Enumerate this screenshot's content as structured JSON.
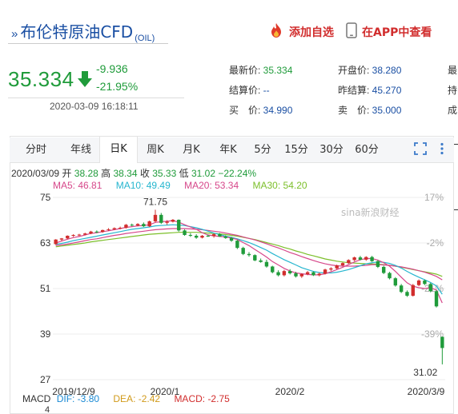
{
  "header": {
    "title_marker": "»",
    "title": "布伦特原油CFD",
    "code": "(OIL)",
    "add_label": "添加自选",
    "app_label": "在APP中查看"
  },
  "quote": {
    "price": "35.334",
    "change": "-9.936",
    "change_pct": "-21.95%",
    "timestamp": "2020-03-09 16:18:11"
  },
  "stats": {
    "c1": [
      {
        "label": "最新价: ",
        "value": "35.334"
      },
      {
        "label": "结算价: ",
        "value": "--"
      },
      {
        "label": "买　价: ",
        "value": "34.990"
      }
    ],
    "c2": [
      {
        "label": "开盘价: ",
        "value": "38.280"
      },
      {
        "label": "昨结算: ",
        "value": "45.270"
      },
      {
        "label": "卖　价: ",
        "value": "35.000"
      }
    ],
    "c3": [
      {
        "label": "最"
      },
      {
        "label": "持"
      },
      {
        "label": "成"
      }
    ]
  },
  "tabs": [
    "分时",
    "年线",
    "日K",
    "周K",
    "月K",
    "年K",
    "5分",
    "15分",
    "30分",
    "60分"
  ],
  "active_tab": "日K",
  "ohlc": {
    "date": "2020/03/09",
    "open_label": "开",
    "open": "38.28",
    "high_label": "高",
    "high": "38.34",
    "close_label": "收",
    "close": "35.33",
    "low_label": "低",
    "low": "31.02",
    "pct": "−22.24%"
  },
  "ma": {
    "ma5": "MA5: 46.81",
    "ma10": "MA10: 49.49",
    "ma20": "MA20: 53.34",
    "ma30": "MA30: 54.20"
  },
  "colors": {
    "up": "#d12d2d",
    "down": "#1f9b3a",
    "ma5": "#d6478a",
    "ma10": "#26b6cf",
    "ma20": "#d6478a",
    "ma30": "#7cbf2a",
    "title": "#1a4fa3"
  },
  "macd": {
    "label": "MACD",
    "dif": "DIF: -3.80",
    "dea": "DEA: -2.42",
    "macd": "MACD: -2.75",
    "scale": "4"
  },
  "chart_data": {
    "type": "candlestick",
    "y_ticks": [
      "75",
      "63",
      "51",
      "39",
      "27"
    ],
    "y_ticks_right": [
      "17%",
      "-2%",
      "-21%",
      "-39%"
    ],
    "ylim": [
      27,
      75
    ],
    "x_ticks": [
      "2019/12/9",
      "2020/1",
      "2020/2",
      "2020/3/9"
    ],
    "high_label": "71.75",
    "low_label": "31.02",
    "watermark": "sina新浪财经",
    "candles": [
      [
        62.7,
        64.0,
        62.5,
        63.9
      ],
      [
        63.9,
        64.3,
        63.5,
        64.2
      ],
      [
        64.2,
        65.0,
        64.0,
        64.9
      ],
      [
        64.9,
        65.3,
        64.6,
        65.1
      ],
      [
        65.1,
        65.4,
        64.8,
        65.2
      ],
      [
        65.2,
        65.7,
        65.0,
        65.5
      ],
      [
        65.5,
        66.2,
        65.3,
        66.0
      ],
      [
        66.0,
        66.3,
        65.6,
        65.9
      ],
      [
        65.9,
        66.5,
        65.7,
        66.4
      ],
      [
        66.4,
        66.9,
        66.2,
        66.6
      ],
      [
        66.6,
        67.1,
        66.4,
        66.9
      ],
      [
        66.9,
        67.3,
        66.6,
        67.0
      ],
      [
        67.0,
        68.0,
        66.8,
        67.8
      ],
      [
        67.8,
        68.1,
        67.4,
        67.6
      ],
      [
        67.6,
        68.2,
        67.4,
        68.0
      ],
      [
        68.0,
        68.4,
        67.2,
        67.4
      ],
      [
        67.4,
        68.9,
        67.2,
        68.7
      ],
      [
        68.7,
        71.75,
        68.4,
        70.4
      ],
      [
        70.4,
        70.9,
        68.0,
        68.3
      ],
      [
        68.3,
        69.0,
        67.8,
        68.6
      ],
      [
        68.6,
        69.3,
        68.4,
        69.1
      ],
      [
        69.1,
        69.2,
        66.0,
        66.3
      ],
      [
        66.3,
        66.6,
        64.9,
        65.1
      ],
      [
        65.1,
        65.6,
        64.6,
        64.9
      ],
      [
        64.9,
        65.3,
        64.1,
        64.4
      ],
      [
        64.4,
        65.1,
        64.2,
        64.9
      ],
      [
        64.9,
        65.2,
        64.6,
        64.8
      ],
      [
        64.8,
        65.5,
        64.4,
        65.3
      ],
      [
        65.3,
        65.6,
        64.6,
        64.7
      ],
      [
        64.7,
        65.0,
        64.1,
        64.3
      ],
      [
        64.3,
        64.6,
        63.3,
        63.6
      ],
      [
        63.6,
        63.8,
        61.4,
        61.7
      ],
      [
        61.7,
        62.0,
        59.8,
        60.1
      ],
      [
        60.1,
        60.6,
        59.4,
        59.8
      ],
      [
        59.8,
        60.0,
        58.2,
        58.4
      ],
      [
        58.4,
        58.9,
        57.8,
        58.0
      ],
      [
        58.0,
        58.6,
        56.5,
        56.8
      ],
      [
        56.8,
        57.0,
        55.0,
        55.3
      ],
      [
        55.3,
        55.8,
        54.2,
        54.5
      ],
      [
        54.5,
        55.9,
        54.2,
        55.6
      ],
      [
        55.6,
        56.1,
        54.7,
        55.0
      ],
      [
        55.0,
        55.4,
        53.9,
        54.2
      ],
      [
        54.2,
        55.0,
        53.8,
        54.8
      ],
      [
        54.8,
        55.6,
        54.5,
        55.3
      ],
      [
        55.3,
        55.5,
        54.3,
        54.5
      ],
      [
        54.5,
        55.2,
        54.2,
        54.9
      ],
      [
        54.9,
        56.2,
        54.7,
        56.0
      ],
      [
        56.0,
        56.6,
        55.6,
        56.3
      ],
      [
        56.3,
        57.3,
        56.0,
        57.1
      ],
      [
        57.1,
        57.9,
        56.8,
        57.7
      ],
      [
        57.7,
        58.7,
        57.5,
        58.5
      ],
      [
        58.5,
        59.4,
        58.2,
        59.2
      ],
      [
        59.2,
        59.6,
        58.4,
        58.6
      ],
      [
        58.6,
        59.5,
        58.3,
        59.3
      ],
      [
        59.3,
        59.6,
        58.0,
        58.2
      ],
      [
        58.2,
        58.5,
        56.4,
        56.7
      ],
      [
        56.7,
        57.0,
        54.8,
        55.1
      ],
      [
        55.1,
        55.4,
        53.4,
        53.7
      ],
      [
        53.7,
        54.0,
        51.5,
        51.8
      ],
      [
        51.8,
        52.2,
        49.8,
        50.1
      ],
      [
        50.1,
        50.5,
        48.8,
        49.1
      ],
      [
        49.1,
        52.2,
        48.9,
        51.9
      ],
      [
        51.9,
        53.4,
        51.6,
        53.1
      ],
      [
        53.1,
        53.4,
        51.9,
        52.2
      ],
      [
        52.2,
        52.5,
        50.0,
        50.3
      ],
      [
        50.3,
        50.6,
        46.0,
        46.3
      ],
      [
        38.28,
        38.34,
        31.02,
        35.33
      ]
    ],
    "ma5": [
      63.0,
      63.5,
      64.0,
      64.4,
      64.7,
      65.1,
      65.5,
      65.7,
      66.0,
      66.2,
      66.5,
      66.8,
      67.1,
      67.3,
      67.5,
      67.6,
      67.8,
      68.4,
      68.6,
      68.7,
      68.9,
      68.5,
      67.8,
      67.2,
      66.6,
      65.7,
      65.1,
      64.9,
      64.7,
      64.6,
      64.3,
      63.9,
      63.1,
      62.3,
      61.3,
      60.3,
      59.3,
      58.1,
      57.2,
      56.3,
      55.6,
      55.1,
      54.9,
      54.7,
      54.6,
      54.6,
      54.9,
      55.4,
      56.0,
      56.6,
      57.3,
      58.0,
      58.6,
      58.9,
      58.9,
      58.5,
      57.8,
      56.9,
      55.5,
      54.0,
      52.5,
      51.6,
      51.2,
      51.0,
      51.2,
      50.6,
      47.2
    ],
    "ma10": [
      62.6,
      62.9,
      63.2,
      63.6,
      63.9,
      64.2,
      64.5,
      64.8,
      65.1,
      65.4,
      65.7,
      66.0,
      66.3,
      66.6,
      66.8,
      67.0,
      67.2,
      67.5,
      67.6,
      67.7,
      67.8,
      67.7,
      67.6,
      67.3,
      67.0,
      66.6,
      66.1,
      65.6,
      65.2,
      64.8,
      64.5,
      64.1,
      63.6,
      63.1,
      62.5,
      61.8,
      61.1,
      60.2,
      59.4,
      58.6,
      57.9,
      57.2,
      56.5,
      56.0,
      55.5,
      55.2,
      55.1,
      55.1,
      55.3,
      55.6,
      56.0,
      56.5,
      57.0,
      57.5,
      57.8,
      58.0,
      57.9,
      57.6,
      57.1,
      56.4,
      55.5,
      54.7,
      54.0,
      53.3,
      52.6,
      51.7,
      49.5
    ],
    "ma20": [
      62.3,
      62.5,
      62.7,
      63.0,
      63.3,
      63.6,
      63.9,
      64.1,
      64.4,
      64.7,
      65.0,
      65.2,
      65.5,
      65.7,
      65.9,
      66.1,
      66.3,
      66.5,
      66.6,
      66.7,
      66.8,
      66.8,
      66.8,
      66.7,
      66.6,
      66.5,
      66.3,
      66.1,
      65.9,
      65.6,
      65.3,
      65.0,
      64.6,
      64.2,
      63.8,
      63.3,
      62.8,
      62.2,
      61.7,
      61.1,
      60.5,
      60.0,
      59.4,
      58.9,
      58.4,
      57.9,
      57.5,
      57.2,
      57.0,
      56.9,
      56.9,
      56.9,
      57.0,
      57.1,
      57.3,
      57.3,
      57.2,
      57.1,
      56.9,
      56.7,
      56.4,
      56.1,
      55.7,
      55.3,
      54.8,
      54.2,
      53.3
    ],
    "ma30": [
      62.0,
      62.2,
      62.4,
      62.6,
      62.8,
      63.0,
      63.3,
      63.5,
      63.7,
      63.9,
      64.1,
      64.3,
      64.5,
      64.7,
      64.9,
      65.1,
      65.3,
      65.4,
      65.5,
      65.6,
      65.7,
      65.8,
      65.8,
      65.8,
      65.8,
      65.7,
      65.6,
      65.5,
      65.4,
      65.2,
      65.0,
      64.8,
      64.5,
      64.2,
      63.9,
      63.5,
      63.1,
      62.7,
      62.3,
      61.8,
      61.4,
      60.9,
      60.5,
      60.0,
      59.6,
      59.2,
      58.8,
      58.5,
      58.2,
      58.0,
      57.8,
      57.7,
      57.6,
      57.5,
      57.5,
      57.4,
      57.3,
      57.1,
      56.9,
      56.6,
      56.3,
      56.0,
      55.7,
      55.4,
      55.1,
      54.8,
      54.2
    ]
  }
}
